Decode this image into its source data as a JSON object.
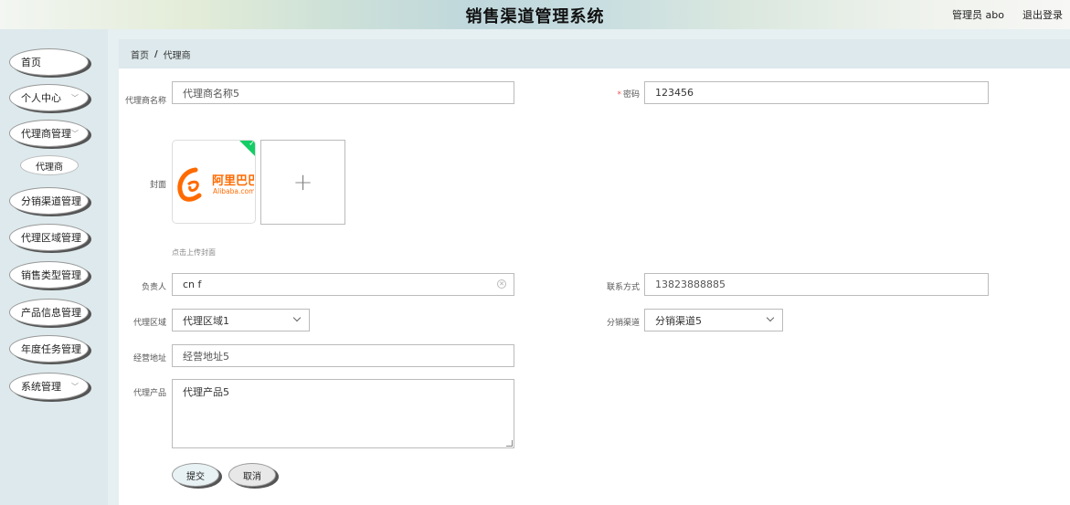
{
  "header": {
    "title": "销售渠道管理系统",
    "user": "管理员 abo",
    "logout": "退出登录"
  },
  "sidebar": {
    "items": [
      {
        "label": "首页"
      },
      {
        "label": "个人中心"
      },
      {
        "label": "代理商管理"
      },
      {
        "label": "代理商"
      },
      {
        "label": "分销渠道管理"
      },
      {
        "label": "代理区域管理"
      },
      {
        "label": "销售类型管理"
      },
      {
        "label": "产品信息管理"
      },
      {
        "label": "年度任务管理"
      },
      {
        "label": "系统管理"
      }
    ]
  },
  "breadcrumb": {
    "home": "首页",
    "separator": "/",
    "current": "代理商"
  },
  "form": {
    "name_label": "代理商名称",
    "name_value": "代理商名称5",
    "password_label": "密码",
    "password_required": "*",
    "password_value": "123456",
    "cover_label": "封面",
    "cover_hint": "点击上传封面",
    "cover_image": {
      "text_cn": "阿里巴巴",
      "text_en": "Alibaba.com"
    },
    "add_icon": "+",
    "owner_label": "负责人",
    "owner_value": "cn f",
    "contact_label": "联系方式",
    "contact_value": "13823888885",
    "region_label": "代理区域",
    "region_value": "代理区域1",
    "channel_label": "分销渠道",
    "channel_value": "分销渠道5",
    "address_label": "经营地址",
    "address_value": "经营地址5",
    "product_label": "代理产品",
    "product_value": "代理产品5"
  },
  "buttons": {
    "submit": "提交",
    "cancel": "取消"
  },
  "colors": {
    "accent_green": "#13ce66",
    "logo_orange": "#ff6a00"
  }
}
